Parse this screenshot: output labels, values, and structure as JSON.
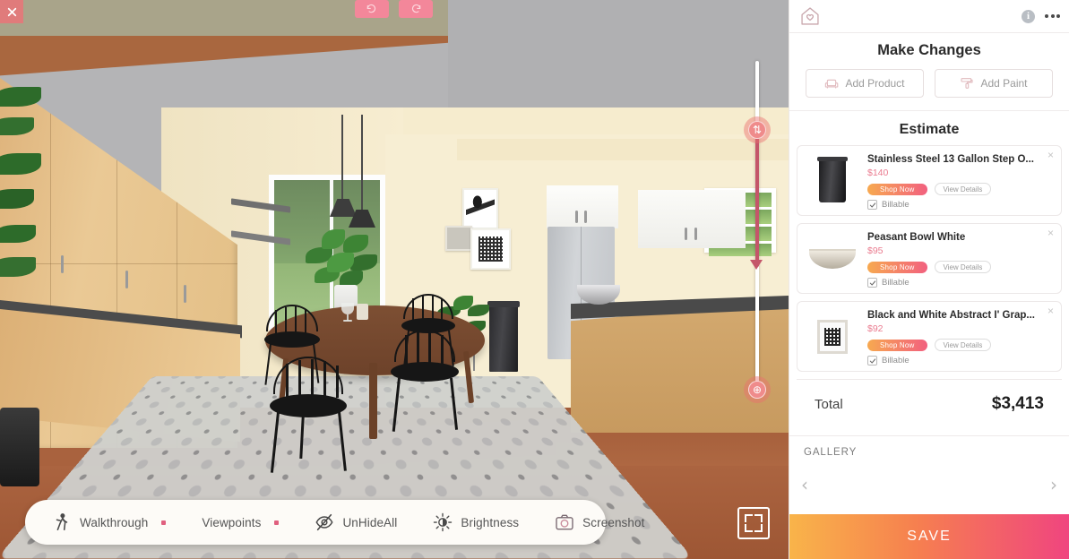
{
  "viewport": {
    "close_label": "✕",
    "undo_label": "undo",
    "redo_label": "redo",
    "fullscreen_label": "fullscreen"
  },
  "toolbar": {
    "items": [
      {
        "label": "Walkthrough",
        "icon": "walking-person-icon",
        "dot": true
      },
      {
        "label": "Viewpoints",
        "icon": "viewpoints-icon",
        "dot": true
      },
      {
        "label": "UnHideAll",
        "icon": "eye-off-icon",
        "dot": false
      },
      {
        "label": "Brightness",
        "icon": "brightness-icon",
        "dot": false
      },
      {
        "label": "Screenshot",
        "icon": "camera-icon",
        "dot": false
      }
    ]
  },
  "panel": {
    "logo": "home-heart-logo",
    "info_label": "i",
    "menu_label": "more-options",
    "make_changes": {
      "title": "Make Changes",
      "buttons": [
        {
          "label": "Add Product",
          "icon": "armchair-icon"
        },
        {
          "label": "Add Paint",
          "icon": "paint-roller-icon"
        }
      ]
    },
    "estimate": {
      "title": "Estimate",
      "items": [
        {
          "name": "Stainless Steel 13 Gallon Step O...",
          "price": "$140",
          "shop_label": "Shop Now",
          "details_label": "View Details",
          "billable_label": "Billable",
          "billable_checked": true,
          "thumb": "trash-can-thumb",
          "close_label": "×"
        },
        {
          "name": "Peasant Bowl White",
          "price": "$95",
          "shop_label": "Shop Now",
          "details_label": "View Details",
          "billable_label": "Billable",
          "billable_checked": true,
          "thumb": "bowl-thumb",
          "close_label": "×"
        },
        {
          "name": "Black and White Abstract I' Grap...",
          "price": "$92",
          "shop_label": "Shop Now",
          "details_label": "View Details",
          "billable_label": "Billable",
          "billable_checked": true,
          "thumb": "framed-art-thumb",
          "close_label": "×"
        }
      ],
      "total_label": "Total",
      "total_value": "$3,413"
    },
    "gallery": {
      "title": "GALLERY",
      "prev_label": "‹",
      "next_label": "›"
    },
    "save_label": "SAVE"
  },
  "colors": {
    "accent_pink": "#f0457f",
    "accent_orange": "#f9b44a",
    "price_pink": "#ea7b8f",
    "close_red": "#e07b7b",
    "slider_pink": "#c4566a"
  }
}
